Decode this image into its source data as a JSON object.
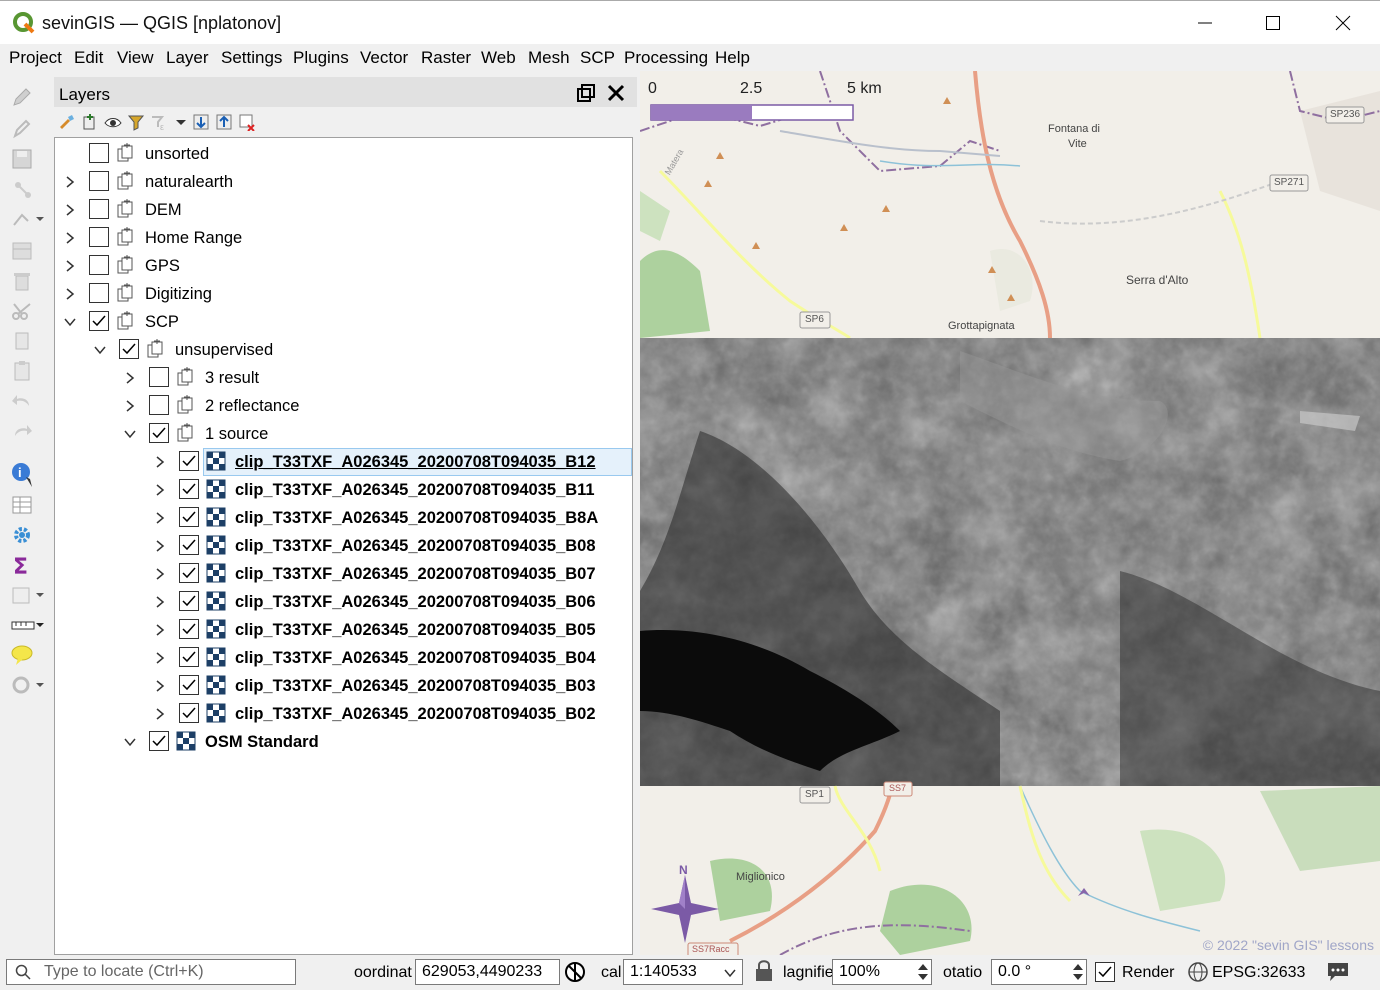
{
  "window": {
    "title": "sevinGIS — QGIS [nplatonov]"
  },
  "menu": [
    "Project",
    "Edit",
    "View",
    "Layer",
    "Settings",
    "Plugins",
    "Vector",
    "Raster",
    "Web",
    "Mesh",
    "SCP",
    "Processing",
    "Help"
  ],
  "layers_panel": {
    "title": "Layers",
    "tree": [
      {
        "label": "unsorted",
        "level": 0,
        "checked": false,
        "expander": "none",
        "type": "group"
      },
      {
        "label": "naturalearth",
        "level": 0,
        "checked": false,
        "expander": "collapsed",
        "type": "group"
      },
      {
        "label": "DEM",
        "level": 0,
        "checked": false,
        "expander": "collapsed",
        "type": "group"
      },
      {
        "label": "Home Range",
        "level": 0,
        "checked": false,
        "expander": "collapsed",
        "type": "group"
      },
      {
        "label": "GPS",
        "level": 0,
        "checked": false,
        "expander": "collapsed",
        "type": "group"
      },
      {
        "label": "Digitizing",
        "level": 0,
        "checked": false,
        "expander": "collapsed",
        "type": "group"
      },
      {
        "label": "SCP",
        "level": 0,
        "checked": true,
        "expander": "expanded",
        "type": "group"
      },
      {
        "label": "unsupervised",
        "level": 1,
        "checked": true,
        "expander": "expanded",
        "type": "group"
      },
      {
        "label": "3 result",
        "level": 2,
        "checked": false,
        "expander": "collapsed",
        "type": "group"
      },
      {
        "label": "2 reflectance",
        "level": 2,
        "checked": false,
        "expander": "collapsed",
        "type": "group"
      },
      {
        "label": "1 source",
        "level": 2,
        "checked": true,
        "expander": "expanded",
        "type": "group"
      },
      {
        "label": "clip_T33TXF_A026345_20200708T094035_B12",
        "level": 3,
        "checked": true,
        "expander": "collapsed",
        "type": "raster",
        "selected": true
      },
      {
        "label": "clip_T33TXF_A026345_20200708T094035_B11",
        "level": 3,
        "checked": true,
        "expander": "collapsed",
        "type": "raster"
      },
      {
        "label": "clip_T33TXF_A026345_20200708T094035_B8A",
        "level": 3,
        "checked": true,
        "expander": "collapsed",
        "type": "raster"
      },
      {
        "label": "clip_T33TXF_A026345_20200708T094035_B08",
        "level": 3,
        "checked": true,
        "expander": "collapsed",
        "type": "raster"
      },
      {
        "label": "clip_T33TXF_A026345_20200708T094035_B07",
        "level": 3,
        "checked": true,
        "expander": "collapsed",
        "type": "raster"
      },
      {
        "label": "clip_T33TXF_A026345_20200708T094035_B06",
        "level": 3,
        "checked": true,
        "expander": "collapsed",
        "type": "raster"
      },
      {
        "label": "clip_T33TXF_A026345_20200708T094035_B05",
        "level": 3,
        "checked": true,
        "expander": "collapsed",
        "type": "raster"
      },
      {
        "label": "clip_T33TXF_A026345_20200708T094035_B04",
        "level": 3,
        "checked": true,
        "expander": "collapsed",
        "type": "raster"
      },
      {
        "label": "clip_T33TXF_A026345_20200708T094035_B03",
        "level": 3,
        "checked": true,
        "expander": "collapsed",
        "type": "raster"
      },
      {
        "label": "clip_T33TXF_A026345_20200708T094035_B02",
        "level": 3,
        "checked": true,
        "expander": "collapsed",
        "type": "raster"
      },
      {
        "label": "OSM Standard",
        "level": 2,
        "checked": true,
        "expander": "expanded",
        "type": "raster",
        "bold": true
      }
    ]
  },
  "map": {
    "scalebar": {
      "labels": [
        "0",
        "2.5",
        "5 km"
      ]
    },
    "place_labels": {
      "fontana": "Fontana di",
      "vite": "Vite",
      "serra": "Serra d'Alto",
      "grottapignata": "Grottapignata",
      "miglionico": "Miglionico",
      "matera": "Matera",
      "sp236": "SP236",
      "sp271": "SP271",
      "sp6": "SP6",
      "sp1": "SP1",
      "ss7": "SS7",
      "ss7racc": "SS7Racc",
      "north": "N"
    },
    "credit": "© 2022 \"sevin GIS\" lessons"
  },
  "statusbar": {
    "locate_placeholder": "Type to locate (Ctrl+K)",
    "coordinate_label": "oordinat",
    "coordinate_value": "629053,4490233",
    "scale_label": "cal",
    "scale_value": "1:140533",
    "magnifier_label": "lagnifie",
    "magnifier_value": "100%",
    "rotation_label": "otatio",
    "rotation_value": "0.0 °",
    "render_label": "Render",
    "render_checked": true,
    "crs": "EPSG:32633"
  },
  "colors": {
    "accent": "#589632",
    "selection": "#e5f1fb",
    "scalebar_fill": "#9a7bbf",
    "boundary": "#8f6fa0"
  }
}
